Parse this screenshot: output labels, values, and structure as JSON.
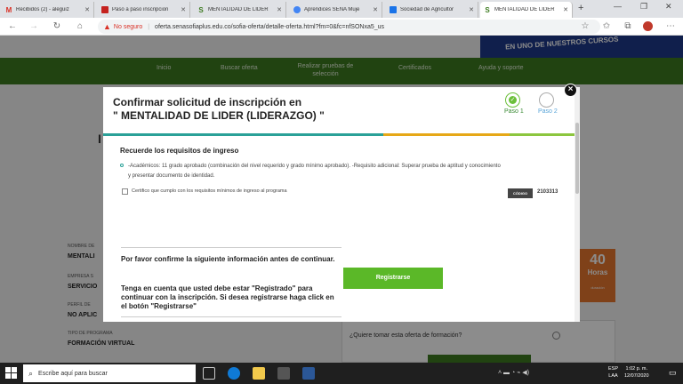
{
  "browser": {
    "tabs": [
      {
        "title": "Recibidos (2) - aleguiz",
        "icon": "gmail-icon",
        "color": "#d93025",
        "glyph": "M"
      },
      {
        "title": "Paso a paso inscripcion",
        "icon": "document-icon",
        "color": "#c5221f",
        "glyph": "▪"
      },
      {
        "title": "MENTALIDAD DE LIDER",
        "icon": "sena-icon",
        "color": "#3c7a1f",
        "glyph": "S"
      },
      {
        "title": "Aprendices SENA Muje",
        "icon": "chrome-icon",
        "color": "#4285f4",
        "glyph": "●"
      },
      {
        "title": "Sociedad de Agricultor",
        "icon": "calendar-icon",
        "color": "#1a73e8",
        "glyph": "▪"
      },
      {
        "title": "MENTALIDAD DE LIDER",
        "icon": "sena-icon",
        "color": "#3c7a1f",
        "glyph": "S"
      }
    ],
    "new_tab": "+",
    "security_warning": "No seguro",
    "url": "oferta.senasofiaplus.edu.co/sofia-oferta/detalle-oferta.html?fm=0&fc=nfSONxa5_us"
  },
  "site": {
    "banner_text": "EN UNO DE NUESTROS CURSOS",
    "nav": [
      "Inicio",
      "Buscar oferta",
      "Realizar pruebas de selección",
      "Certificados",
      "Ayuda y soporte"
    ]
  },
  "background_page": {
    "labels": [
      "NOMBRE DE",
      "EMPRESA S",
      "PERFIL DE",
      "TIPO DE PROGRAMA"
    ],
    "values": [
      "MENTALI",
      "SERVICIO",
      "NO APLIC",
      "FORMACIÓN VIRTUAL"
    ],
    "hours_num": "40",
    "hours_word": "Horas",
    "hours_sub": "duración",
    "question": "¿Quiere tomar esta oferta de formación?"
  },
  "modal": {
    "title_line1": "Confirmar solicitud de inscripción en",
    "title_line2": "\" MENTALIDAD DE LIDER (LIDERAZGO) \"",
    "step1": "Paso 1",
    "step2": "Paso 2",
    "requirements_heading": "Recuerde los requisitos de ingreso",
    "requirements_text": "-Académicos: 11 grado aprobado (combinación del nivel requerido y grado mínimo aprobado). -Requisito adicional: Superar prueba de aptitud y conocimiento y presentar documento de identidad.",
    "certify_text": "Certifico que cumplo con los requisitos mínimos de ingreso al programa",
    "code_label": "CÓDIGO",
    "code_value": "2103313",
    "confirm_heading": "Por favor confirme la siguiente información antes de continuar.",
    "registered_note": "Tenga en cuenta que usted debe estar \"Registrado\" para continuar con la inscripción. Si desea registrarse haga click en el botón \"Registrarse\"",
    "register_button": "Registrarse",
    "close": "×"
  },
  "taskbar": {
    "search_placeholder": "Escribe aquí para buscar",
    "lang": "ESP",
    "lang2": "LAA",
    "time": "1:02 p. m.",
    "date": "12/07/2020"
  },
  "colors": {
    "sena_green": "#3c7a1f",
    "button_green": "#5bb828",
    "step_done": "#3a8a34"
  }
}
